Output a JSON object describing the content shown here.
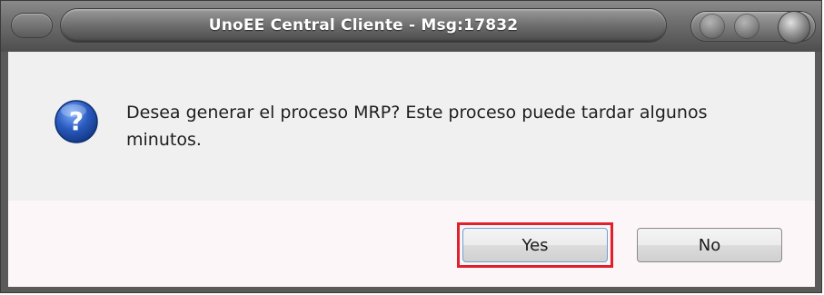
{
  "window": {
    "title": "UnoEE Central Cliente - Msg:17832"
  },
  "dialog": {
    "icon": "question-icon",
    "message": "Desea generar el proceso MRP? Este proceso puede tardar algunos minutos."
  },
  "buttons": {
    "yes_label": "Yes",
    "no_label": "No"
  },
  "colors": {
    "highlight": "#e0202a",
    "icon_blue": "#2a5bbf"
  }
}
